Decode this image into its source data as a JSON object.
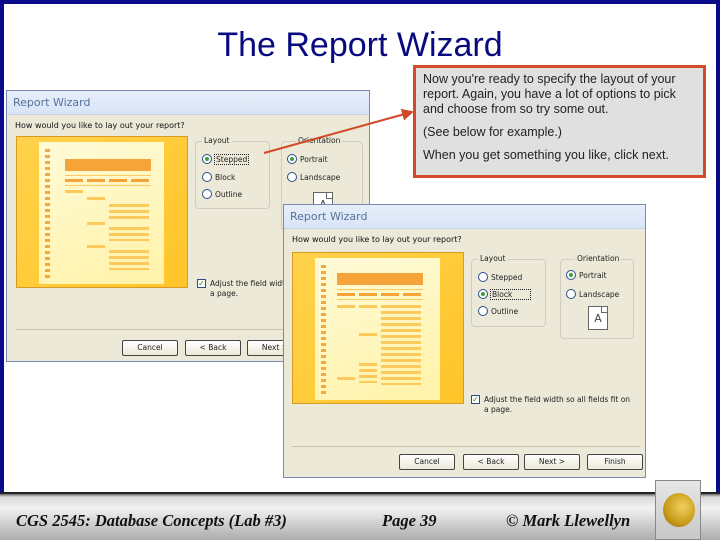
{
  "slide": {
    "title": "The Report Wizard"
  },
  "callout": {
    "paragraphs": [
      "Now you're ready to specify the layout of your report.  Again, you have a lot of options to pick and choose from so try some out.",
      "(See below for example.)",
      "When you get something you like, click next."
    ],
    "border_color": "#d24a26"
  },
  "dialog_back": {
    "title": "Report Wizard",
    "question": "How would you like to lay out your report?",
    "layout_label": "Layout",
    "layout_options": [
      "Stepped",
      "Block",
      "Outline"
    ],
    "layout_selected": "Stepped",
    "orientation_label": "Orientation",
    "orientation_options": [
      "Portrait",
      "Landscape"
    ],
    "orientation_selected": "Portrait",
    "checkbox_label": "Adjust the field width so all fields fit on a page.",
    "checkbox_visible_text": "Adjust the field width",
    "checkbox_line2": "a page.",
    "checkbox_checked": true,
    "buttons": {
      "cancel": "Cancel",
      "back": "< Back",
      "next": "Next >"
    }
  },
  "dialog_front": {
    "title": "Report Wizard",
    "question": "How would you like to lay out your report?",
    "layout_label": "Layout",
    "layout_options": [
      "Stepped",
      "Block",
      "Outline"
    ],
    "layout_selected": "Block",
    "orientation_label": "Orientation",
    "orientation_options": [
      "Portrait",
      "Landscape"
    ],
    "orientation_selected": "Portrait",
    "orientation_icon": "A",
    "checkbox_line1": "Adjust the field width so all fields fit on",
    "checkbox_line2": "a page.",
    "checkbox_checked": true,
    "buttons": {
      "cancel": "Cancel",
      "back": "< Back",
      "next": "Next >",
      "finish": "Finish"
    }
  },
  "footer": {
    "course": "CGS 2545: Database Concepts  (Lab #3)",
    "page": "Page 39",
    "author": "© Mark Llewellyn",
    "logo": "ucf-pegasus-logo"
  }
}
